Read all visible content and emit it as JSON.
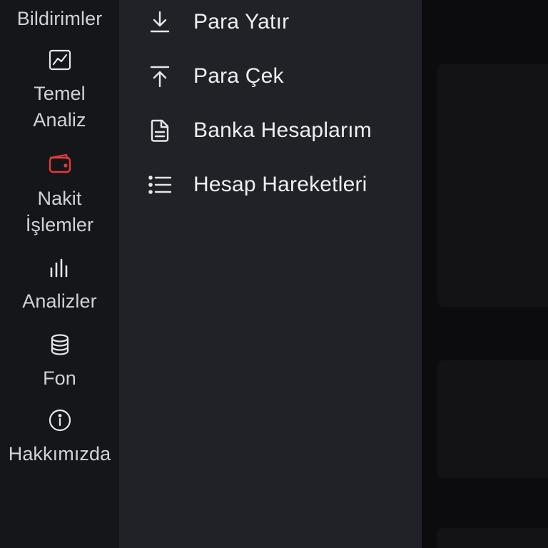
{
  "sidebar": {
    "items": [
      {
        "label": "Bildirimler",
        "icon": "bell-icon"
      },
      {
        "label_line1": "Temel",
        "label_line2": "Analiz",
        "icon": "chart-line-icon"
      },
      {
        "label_line1": "Nakit",
        "label_line2": "İşlemler",
        "icon": "wallet-icon",
        "active": true
      },
      {
        "label": "Analizler",
        "icon": "bar-chart-icon"
      },
      {
        "label": "Fon",
        "icon": "database-icon"
      },
      {
        "label": "Hakkımızda",
        "icon": "info-icon"
      }
    ],
    "active_color": "#e23b3b"
  },
  "submenu": {
    "items": [
      {
        "label": "Para Yatır",
        "icon": "download-icon"
      },
      {
        "label": "Para Çek",
        "icon": "upload-icon"
      },
      {
        "label": "Banka Hesaplarım",
        "icon": "document-icon"
      },
      {
        "label": "Hesap Hareketleri",
        "icon": "list-icon"
      }
    ]
  }
}
